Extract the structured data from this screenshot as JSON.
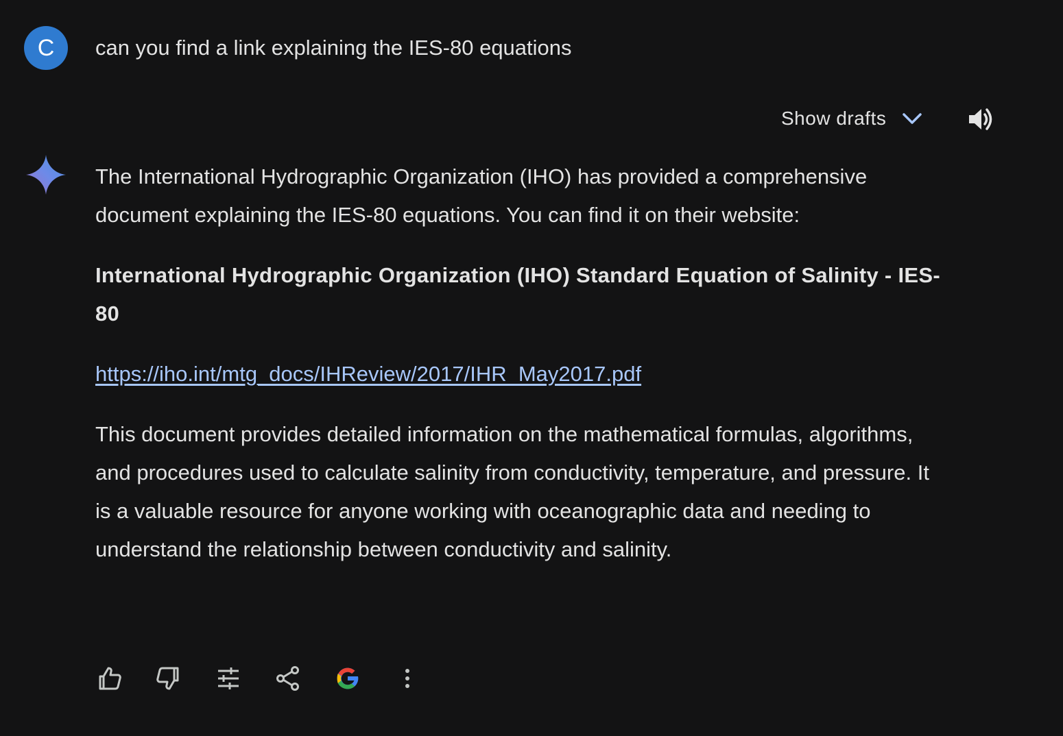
{
  "user": {
    "avatar_letter": "C",
    "prompt": "can you find a link explaining the IES-80 equations"
  },
  "drafts": {
    "label": "Show drafts"
  },
  "icons": {
    "chevron": "chevron-down-icon",
    "speaker": "speaker-icon",
    "sparkle": "gemini-sparkle-icon",
    "thumbs_up": "thumbs-up-icon",
    "thumbs_down": "thumbs-down-icon",
    "modify": "tune-icon",
    "share": "share-icon",
    "google": "google-icon",
    "more": "more-vert-icon"
  },
  "response": {
    "intro": "The International Hydrographic Organization (IHO) has provided a comprehensive document explaining the IES-80 equations. You can find it on their website:",
    "title": "International Hydrographic Organization (IHO) Standard Equation of Salinity - IES-80",
    "link": "https://iho.int/mtg_docs/IHReview/2017/IHR_May2017.pdf",
    "description": "This document provides detailed information on the mathematical formulas, algorithms, and procedures used to calculate salinity from conductivity, temperature, and pressure. It is a valuable resource for anyone working with oceanographic data and needing to understand the relationship between conductivity and salinity."
  },
  "colors": {
    "background": "#131314",
    "text": "#e3e3e3",
    "link": "#a8c7fa",
    "avatar": "#2f7bd0"
  }
}
